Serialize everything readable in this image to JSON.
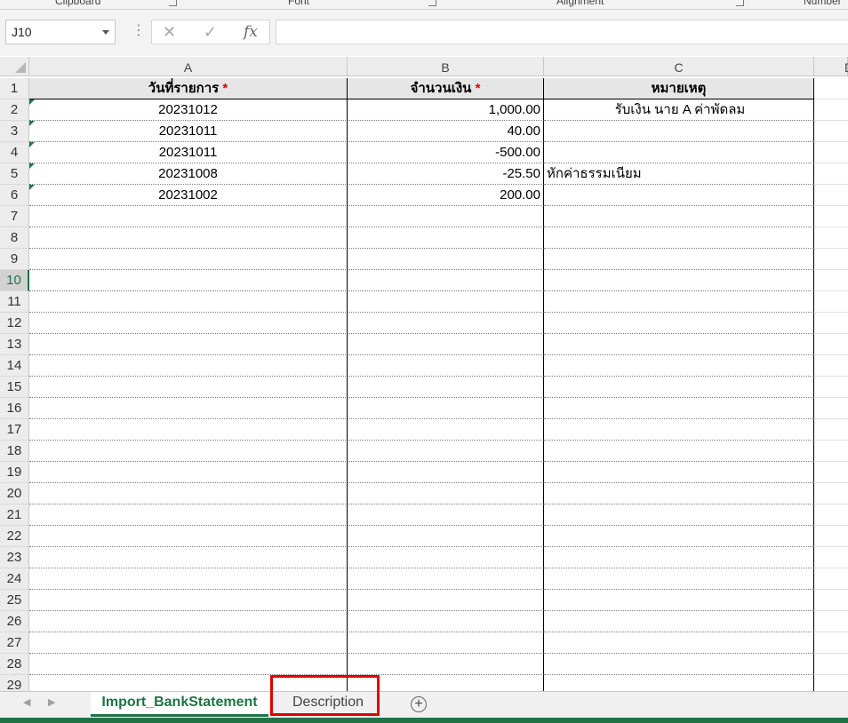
{
  "ribbon": {
    "groups": [
      "Clipboard",
      "Font",
      "Alignment",
      "Number"
    ]
  },
  "formula_bar": {
    "name_box": "J10",
    "cancel_icon": "✕",
    "enter_icon": "✓",
    "fx_label": "fx",
    "formula": ""
  },
  "columns": [
    "A",
    "B",
    "C",
    "D"
  ],
  "rows": [
    "1",
    "2",
    "3",
    "4",
    "5",
    "6",
    "7",
    "8",
    "9",
    "10",
    "11",
    "12",
    "13",
    "14",
    "15",
    "16",
    "17",
    "18",
    "19",
    "20",
    "21",
    "22",
    "23",
    "24",
    "25",
    "26",
    "27",
    "28",
    "29"
  ],
  "selected_row": "10",
  "header_row": {
    "a": "วันที่รายการ",
    "b": "จำนวนเงิน",
    "c": "หมายเหตุ",
    "required_marker": "*"
  },
  "data_rows": [
    {
      "a": "20231012",
      "b": "1,000.00",
      "c": "รับเงิน นาย A ค่าพัดลม"
    },
    {
      "a": "20231011",
      "b": "40.00",
      "c": ""
    },
    {
      "a": "20231011",
      "b": "-500.00",
      "c": ""
    },
    {
      "a": "20231008",
      "b": "-25.50",
      "c": "หักค่าธรรมเนียม"
    },
    {
      "a": "20231002",
      "b": "200.00",
      "c": ""
    }
  ],
  "sheet_tabs": {
    "active": "Import_BankStatement",
    "inactive": "Description",
    "add_icon": "+"
  },
  "colors": {
    "accent": "#217346",
    "header_fill": "#e7e6e6",
    "required": "#e00000",
    "highlight_box": "#e10000"
  }
}
